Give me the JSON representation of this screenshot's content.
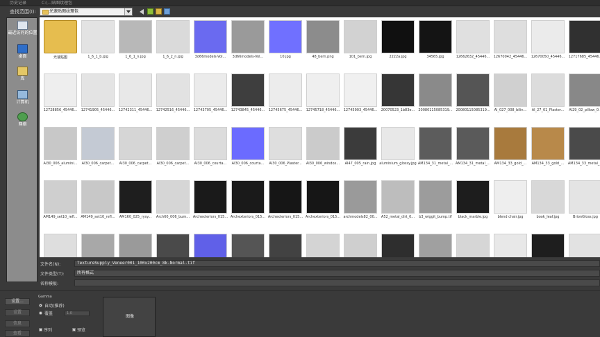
{
  "top_strip": {
    "history_label": "历史记录",
    "path_history": "C:\\...贴图纹理包"
  },
  "look_in": {
    "label": "查找范围(I):",
    "current_path": "光速贴图纹理包"
  },
  "places": [
    {
      "label": "最近访问的位置",
      "icon": "recent-places-icon"
    },
    {
      "label": "桌面",
      "icon": "desktop-icon"
    },
    {
      "label": "库",
      "icon": "libraries-icon"
    },
    {
      "label": "计算机",
      "icon": "computer-icon"
    },
    {
      "label": "网络",
      "icon": "network-icon"
    }
  ],
  "files": [
    [
      "光速贴图",
      "1_6_1_b.jpg",
      "1_6_1_n.jpg",
      "1_6_2_n.jpg",
      "3d66models-Vol...",
      "3d66models-Vol...",
      "10.jpg",
      "48_bern.png",
      "101_bern.jpg",
      "2222a.jpg",
      "34565.jpg",
      "12662632_45446...",
      "12670042_45446...",
      "12670050_45446...",
      "12717685_45446..."
    ],
    [
      "12728856_45446...",
      "12741905_45446...",
      "12742311_45446...",
      "12742516_45446...",
      "12743705_45446...",
      "12743845_45446...",
      "12745675_45446...",
      "12745718_45446...",
      "12745903_45446...",
      "20070523_1b83e...",
      "20080115085319...",
      "20080115085319...",
      "AI_027_008_bilin...",
      "AI_27_01_Plaster...",
      "AI29_02_pillow_0..."
    ],
    [
      "AI30_006_alumini...",
      "AI30_006_carpet...",
      "AI30_006_carpet...",
      "AI30_006_carpet...",
      "AI30_006_courta...",
      "AI30_006_courta...",
      "AI30_006_Plaster...",
      "AI30_006_windox...",
      "AI47_005_rain.jpg",
      "aluminium_glossy.jpg",
      "AM134_31_metal_...",
      "AM134_31_metal_...",
      "AM134_33_gold_...",
      "AM134_33_gold_...",
      "AM134_33_metal_..."
    ],
    [
      "AM149_set10_refl...",
      "AM149_set10_refl...",
      "AM160_025_rysy...",
      "Arch60_006_bum...",
      "Archexteriors_015...",
      "Archexteriors_015...",
      "Archexteriors_015...",
      "Archexteriors_015...",
      "archmodels82_00...",
      "A52_metal_dirt_0...",
      "b3_wiggit_bump.tif",
      "black_marble.jpg",
      "blend chair.jpg",
      "book_leaf.jpg",
      "BrionGloss.jpg"
    ],
    [
      "",
      "",
      "",
      "",
      "",
      "",
      "",
      "",
      "",
      "",
      "",
      "",
      "",
      "",
      ""
    ]
  ],
  "thumb_colors": [
    [
      "#e6bd4f",
      "#e3e3e3",
      "#b8b8b8",
      "#dadada",
      "#6a6af0",
      "#9a9a9a",
      "#7070ff",
      "#8c8c8c",
      "#d2d2d2",
      "#101010",
      "#141414",
      "#e0e0e0",
      "#dedede",
      "#ebebeb",
      "#303030"
    ],
    [
      "#eeeeee",
      "#e4e4e4",
      "#e8e8e8",
      "#e2e2e2",
      "#ebebeb",
      "#3e3e3e",
      "#ececec",
      "#efefef",
      "#f0f0f0",
      "#363636",
      "#8a8a8a",
      "#555555",
      "#d0d0d0",
      "#dcdcdc",
      "#888888"
    ],
    [
      "#c8c8c8",
      "#c4cad4",
      "#d6d6d6",
      "#cfcfcf",
      "#dcdcdc",
      "#6b6bff",
      "#dedede",
      "#cbcbcb",
      "#3b3b3b",
      "#e8e8e8",
      "#5c5c5c",
      "#5a5a5a",
      "#a87a3d",
      "#b8894a",
      "#4a4a4a"
    ],
    [
      "#cfcfcf",
      "#c8c8c8",
      "#1e1e1e",
      "#d6d6d6",
      "#1a1a1a",
      "#1a1a1a",
      "#161616",
      "#161616",
      "#9a9a9a",
      "#bdbdbd",
      "#9c9c9c",
      "#1d1d1d",
      "#eeeeee",
      "#d8d8d8",
      "#e4e4e4"
    ],
    [
      "#dedede",
      "#a8a8a8",
      "#9a9a9a",
      "#4a4a4a",
      "#6060e8",
      "#555555",
      "#424242",
      "#d4d4d4",
      "#cfcfcf",
      "#2e2e2e",
      "#a0a0a0",
      "#d6d6d6",
      "#e8e8e8",
      "#1e1e1e",
      "#e2e2e2"
    ]
  ],
  "file_name": {
    "label": "文件名(N):",
    "value": "TextureSupply_Veneer001_100x200cm_8k-Normal.tif"
  },
  "file_type": {
    "label": "文件类型(T):",
    "value": "所有格式"
  },
  "name_template": {
    "label": "名称模板:",
    "value": ""
  },
  "buttons": {
    "setup": "设置...",
    "settings": "设置",
    "info": "信息",
    "view": "查看"
  },
  "gamma": {
    "title": "Gamma",
    "auto_label": "自动(推荐)",
    "override_label": "覆盖",
    "override_value": "1.0"
  },
  "sequence_label": "序列",
  "preview_label": "预览",
  "preview_text": "图像"
}
